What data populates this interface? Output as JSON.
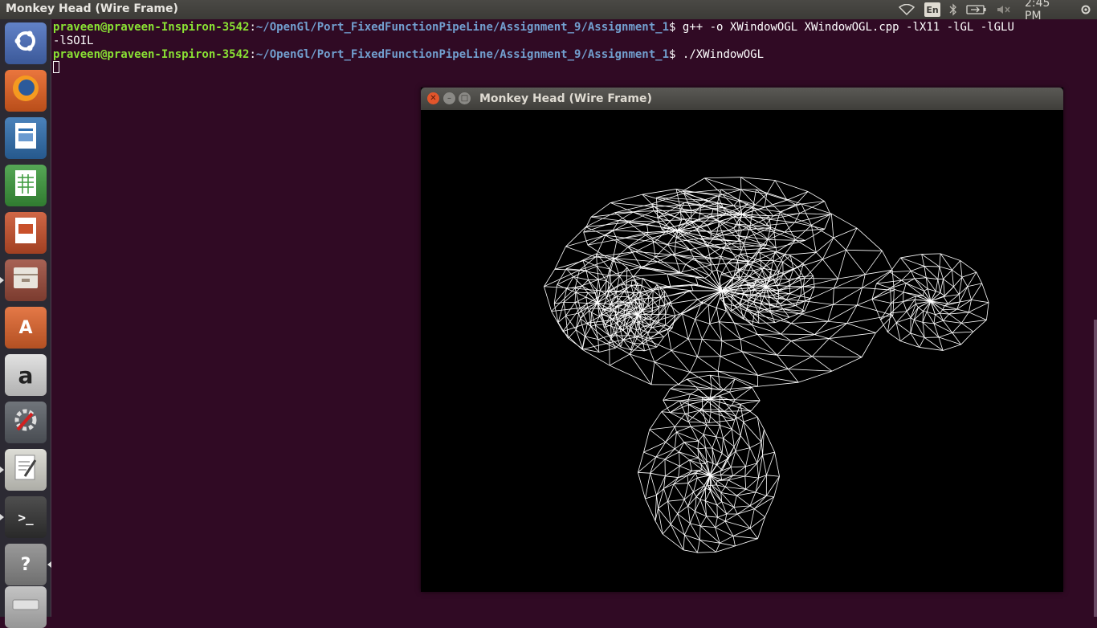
{
  "panel": {
    "window_title": "Monkey Head (Wire Frame)",
    "keyboard_layout": "En",
    "clock": "2:45 PM",
    "indicators": [
      "wifi-icon",
      "keyboard-layout",
      "bluetooth-icon",
      "battery-icon",
      "volume-muted-icon"
    ]
  },
  "launcher": {
    "items": [
      {
        "name": "ubuntu-dash",
        "icon": "ubuntu-logo-icon",
        "color": "#4a6fbf"
      },
      {
        "name": "firefox",
        "icon": "firefox-icon",
        "color": "#e76120"
      },
      {
        "name": "libreoffice-writer",
        "icon": "writer-icon",
        "color": "#2f6fb0"
      },
      {
        "name": "libreoffice-calc",
        "icon": "calc-icon",
        "color": "#3c9a3c"
      },
      {
        "name": "libreoffice-impress",
        "icon": "impress-icon",
        "color": "#c9502a"
      },
      {
        "name": "files",
        "icon": "files-icon",
        "color": "#9a4a3a"
      },
      {
        "name": "software-center",
        "icon": "software-center-icon",
        "color": "#e0642b"
      },
      {
        "name": "amazon",
        "icon": "amazon-icon",
        "color": "#dddddd"
      },
      {
        "name": "system-settings",
        "icon": "settings-icon",
        "color": "#5a5f66"
      },
      {
        "name": "text-editor",
        "icon": "text-editor-icon",
        "color": "#d8d8d0"
      },
      {
        "name": "terminal",
        "icon": "terminal-icon",
        "color": "#333333"
      },
      {
        "name": "help",
        "icon": "help-icon",
        "color": "#8a8a8a"
      },
      {
        "name": "drive",
        "icon": "drive-icon",
        "color": "#bbbbbb"
      }
    ],
    "glyphs": {
      "amazon": "a",
      "help": "?",
      "terminal": ">_",
      "software-center": "A"
    }
  },
  "terminal": {
    "prompt_user": "praveen@praveen-Inspiron-3542",
    "prompt_path": "~/OpenGl/Port_FixedFunctionPipeLine/Assignment_9/Assignment_1",
    "prompt_sep": ":",
    "prompt_end": "$ ",
    "line1_cmd": "g++ -o XWindowOGL XWindowOGL.cpp -lX11 -lGL -lGLU",
    "line1_wrap": "-lSOIL",
    "line2_cmd": "./XWindowOGL"
  },
  "gl_window": {
    "title": "Monkey Head (Wire Frame)",
    "close_glyph": "✕",
    "min_glyph": "–",
    "max_glyph": "□",
    "background": "#000000",
    "wire_color": "#ffffff"
  }
}
